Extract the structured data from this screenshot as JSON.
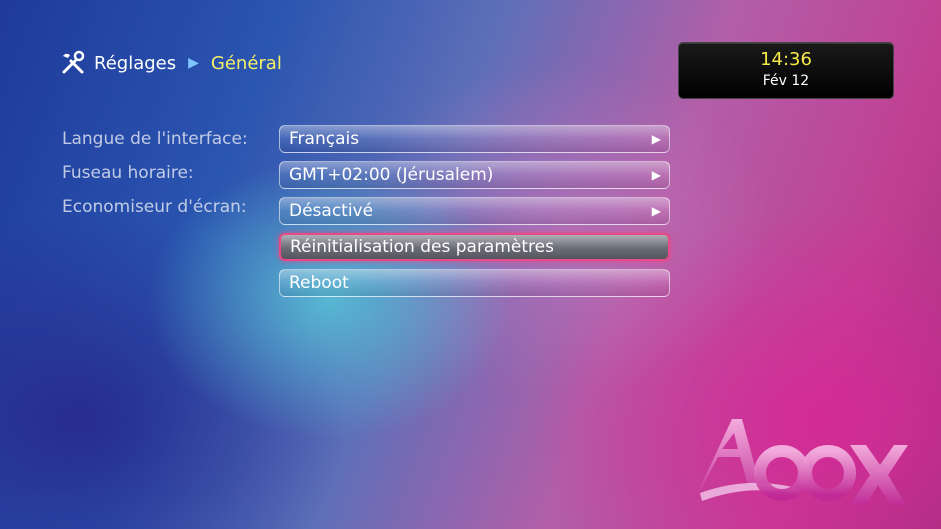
{
  "breadcrumb": {
    "icon": "tools-icon",
    "parent": "Réglages",
    "current": "Général"
  },
  "clock": {
    "time": "14:36",
    "date": "Fév 12"
  },
  "settings": {
    "labels": [
      "Langue de l'interface:",
      "Fuseau horaire:",
      "Economiseur d'écran:"
    ],
    "items": [
      {
        "label": "Français",
        "has_arrow": true
      },
      {
        "label": "GMT+02:00 (Jérusalem)",
        "has_arrow": true
      },
      {
        "label": "Désactivé",
        "has_arrow": true
      },
      {
        "label": "Réinitialisation des paramètres",
        "has_arrow": false,
        "selected": true
      },
      {
        "label": "Reboot",
        "has_arrow": false
      }
    ],
    "arrow_glyph": "▶"
  },
  "logo": {
    "text": "Abox"
  },
  "colors": {
    "accent_yellow": "#f2ef6a",
    "selection_border": "#e84a87"
  }
}
